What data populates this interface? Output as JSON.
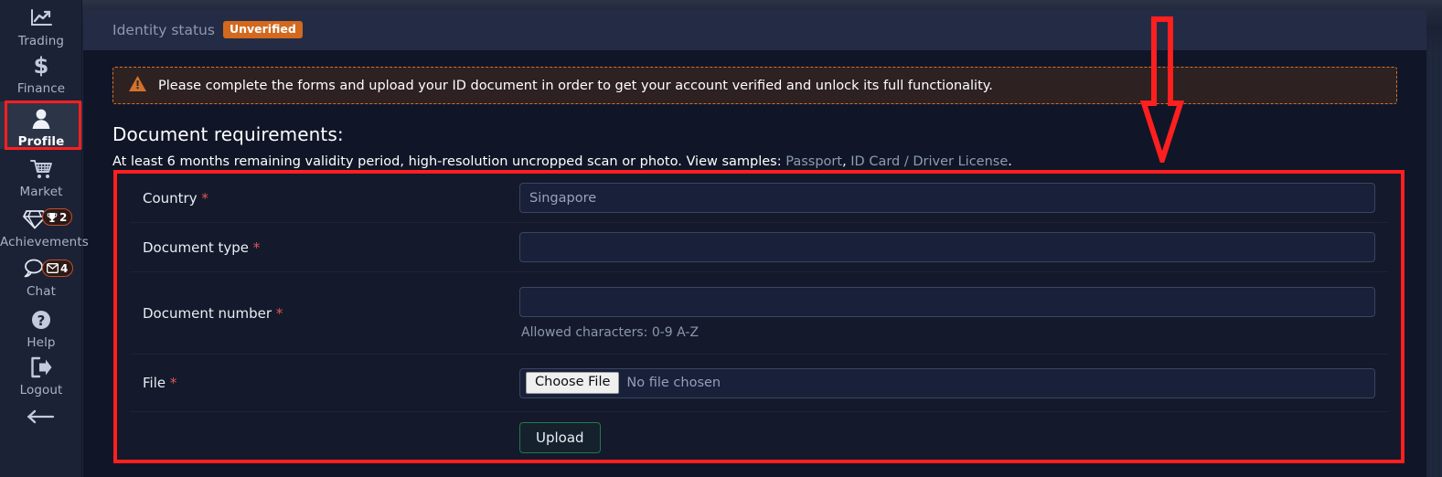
{
  "sidebar": {
    "items": [
      {
        "label": "Trading",
        "icon": "chart-line-icon",
        "active": false,
        "badge": null
      },
      {
        "label": "Finance",
        "icon": "dollar-icon",
        "active": false,
        "badge": null
      },
      {
        "label": "Profile",
        "icon": "user-icon",
        "active": true,
        "badge": null
      },
      {
        "label": "Market",
        "icon": "cart-icon",
        "active": false,
        "badge": null
      },
      {
        "label": "Achievements",
        "icon": "diamond-icon",
        "active": false,
        "badge": {
          "icon": "trophy-icon",
          "count": "2"
        }
      },
      {
        "label": "Chat",
        "icon": "speech-bubble-icon",
        "active": false,
        "badge": {
          "icon": "envelope-icon",
          "count": "4"
        }
      },
      {
        "label": "Help",
        "icon": "question-mark-icon",
        "active": false,
        "badge": null
      },
      {
        "label": "Logout",
        "icon": "logout-icon",
        "active": false,
        "badge": null
      }
    ],
    "collapse_icon": "arrow-left-icon"
  },
  "header": {
    "status_label": "Identity status",
    "status_badge": "Unverified"
  },
  "alert": {
    "icon": "warning-triangle-icon",
    "text": "Please complete the forms and upload your ID document in order to get your account verified and unlock its full functionality."
  },
  "requirements": {
    "title": "Document requirements:",
    "text_before": "At least 6 months remaining validity period, high-resolution uncropped scan or photo. View samples: ",
    "link_passport": "Passport",
    "separator": ", ",
    "link_idcard": "ID Card / Driver License",
    "text_after": "."
  },
  "form": {
    "rows": [
      {
        "label": "Country",
        "required": "*",
        "value": "Singapore",
        "placeholder": "",
        "hint": ""
      },
      {
        "label": "Document type",
        "required": "*",
        "value": "",
        "placeholder": "",
        "hint": ""
      },
      {
        "label": "Document number",
        "required": "*",
        "value": "",
        "placeholder": "",
        "hint": "Allowed characters: 0-9 A-Z"
      },
      {
        "label": "File",
        "required": "*",
        "value": "",
        "placeholder": "",
        "hint": ""
      }
    ],
    "file": {
      "choose_label": "Choose File",
      "no_file_text": "No file chosen"
    },
    "submit_label": "Upload"
  },
  "annotations": {
    "arrow_color": "#ff1f1f",
    "highlight_color": "#ff1f1f"
  },
  "colors": {
    "accent_orange": "#d2691e",
    "panel_bg": "#101627",
    "sidebar_bg": "#1b2236",
    "status_bar_bg": "#242c45",
    "green": "#1f7a4d"
  }
}
